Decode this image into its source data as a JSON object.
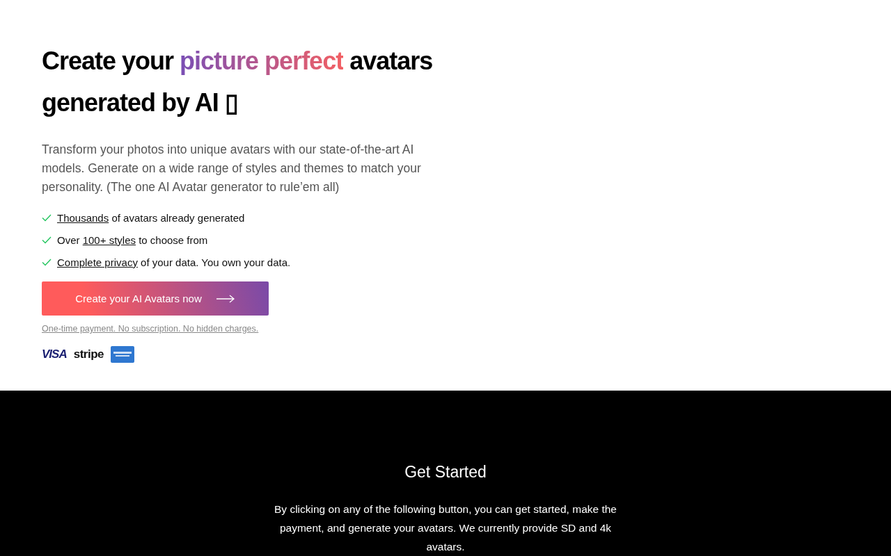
{
  "hero": {
    "heading": {
      "before": "Create your ",
      "highlight": "picture perfect",
      "after": " avatars generated by AI ▯"
    },
    "description": "Transform your photos into unique avatars with our state-of-the-art AI models. Generate on a wide range of styles and themes to match your personality. (The one AI Avatar generator to rule’em all)",
    "features": [
      {
        "link": "Thousands",
        "after": " of avatars already generated"
      },
      {
        "before": "Over ",
        "link": "100+ styles",
        "after": " to choose from"
      },
      {
        "link": "Complete privacy",
        "after": " of your data. You own your data."
      }
    ],
    "cta_button": "Create your AI Avatars now",
    "payment_note": "One-time payment. No subscription. No hidden charges.",
    "payment_logos": [
      {
        "kind": "visa",
        "text": "VISA"
      },
      {
        "kind": "stripe",
        "text": "stripe"
      },
      {
        "kind": "amex"
      }
    ]
  },
  "get_started": {
    "title": "Get Started",
    "text": "By clicking on any of the following button, you can get started, make the payment, and generate your avatars. We currently provide SD and 4k avatars."
  }
}
